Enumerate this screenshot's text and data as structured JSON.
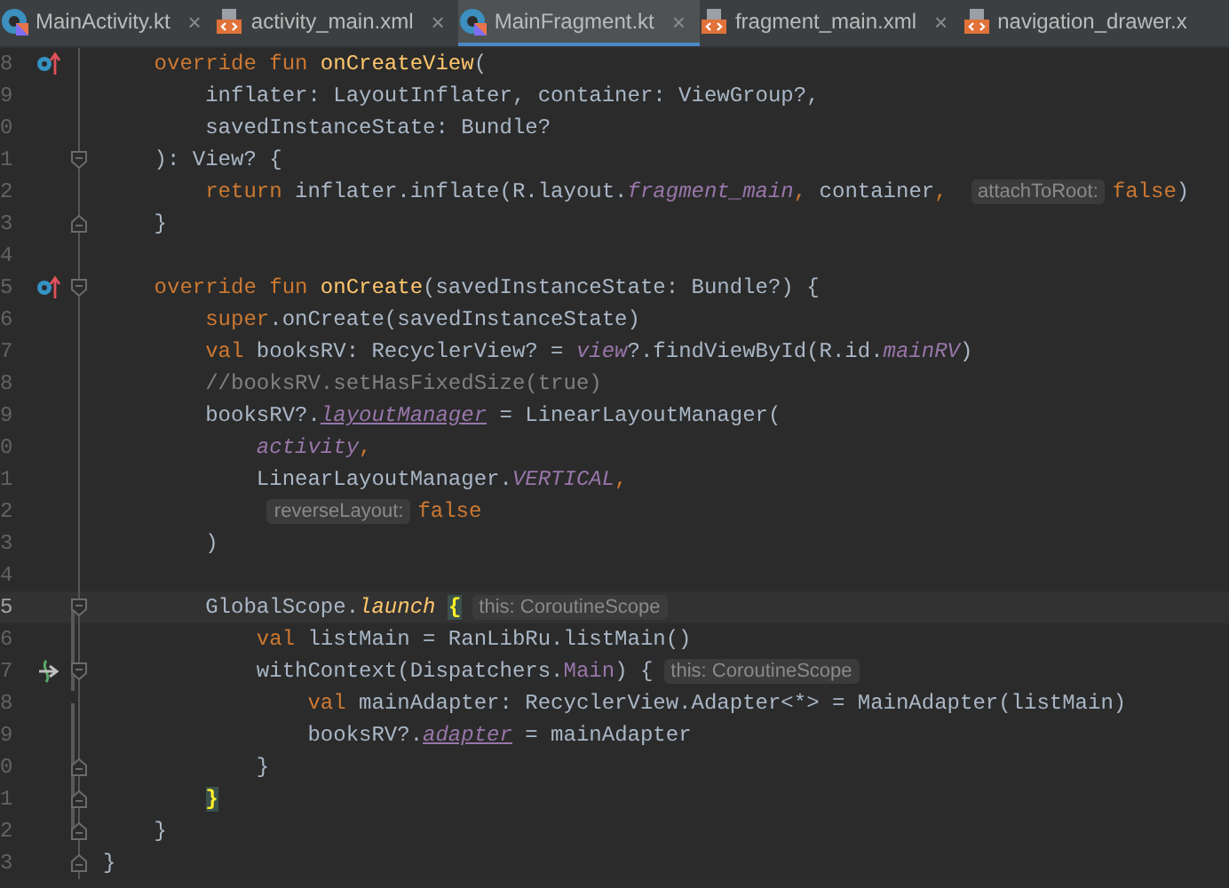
{
  "tabs": [
    {
      "label": "MainActivity.kt",
      "kind": "kotlin",
      "selected": false,
      "close": "×"
    },
    {
      "label": "activity_main.xml",
      "kind": "xml",
      "selected": false,
      "close": "×"
    },
    {
      "label": "MainFragment.kt",
      "kind": "kotlin",
      "selected": true,
      "close": "×"
    },
    {
      "label": "fragment_main.xml",
      "kind": "xml",
      "selected": false,
      "close": "×"
    },
    {
      "label": "navigation_drawer.x",
      "kind": "xml",
      "selected": false
    }
  ],
  "editor": {
    "lines": [
      {
        "number": "8",
        "gutter_icon": {
          "kind": "override"
        },
        "tokens": [
          {
            "kind": "keyword",
            "text": "    override fun "
          },
          {
            "kind": "function",
            "text": "onCreateView"
          },
          {
            "kind": "plain",
            "text": "("
          }
        ]
      },
      {
        "number": "9",
        "tokens": [
          {
            "kind": "plain",
            "text": "        inflater: LayoutInflater, container: ViewGroup?,"
          }
        ]
      },
      {
        "number": "0",
        "tokens": [
          {
            "kind": "plain",
            "text": "        savedInstanceState: Bundle?"
          }
        ]
      },
      {
        "number": "1",
        "fold_mark": {
          "kind": "start"
        },
        "tokens": [
          {
            "kind": "plain",
            "text": "    ): View? {"
          }
        ]
      },
      {
        "number": "2",
        "tokens": [
          {
            "kind": "keyword",
            "text": "        return "
          },
          {
            "kind": "plain",
            "text": "inflater.inflate(R.layout."
          },
          {
            "kind": "field",
            "text": "fragment_main"
          },
          {
            "kind": "keyword",
            "text": ", "
          },
          {
            "kind": "plain",
            "text": "container"
          },
          {
            "kind": "keyword",
            "text": ", "
          },
          {
            "kind": "hint",
            "text": "attachToRoot:"
          },
          {
            "kind": "keyword",
            "text": "false"
          },
          {
            "kind": "plain",
            "text": ")"
          }
        ]
      },
      {
        "number": "3",
        "fold_mark": {
          "kind": "end"
        },
        "tokens": [
          {
            "kind": "plain",
            "text": "    }"
          }
        ]
      },
      {
        "number": "4"
      },
      {
        "number": "5",
        "gutter_icon": {
          "kind": "override"
        },
        "fold_mark": {
          "kind": "start"
        },
        "tokens": [
          {
            "kind": "keyword",
            "text": "    override fun "
          },
          {
            "kind": "function",
            "text": "onCreate"
          },
          {
            "kind": "plain",
            "text": "(savedInstanceState: Bundle?) {"
          }
        ]
      },
      {
        "number": "6",
        "tokens": [
          {
            "kind": "keyword",
            "text": "        super"
          },
          {
            "kind": "plain",
            "text": ".onCreate(savedInstanceState)"
          }
        ]
      },
      {
        "number": "7",
        "tokens": [
          {
            "kind": "keyword",
            "text": "        val "
          },
          {
            "kind": "plain",
            "text": "booksRV: RecyclerView? = "
          },
          {
            "kind": "field",
            "text": "view"
          },
          {
            "kind": "plain",
            "text": "?.findViewById(R.id."
          },
          {
            "kind": "field",
            "text": "mainRV"
          },
          {
            "kind": "plain",
            "text": ")"
          }
        ]
      },
      {
        "number": "8",
        "tokens": [
          {
            "kind": "comment",
            "text": "        //booksRV.setHasFixedSize(true)"
          }
        ]
      },
      {
        "number": "9",
        "tokens": [
          {
            "kind": "plain",
            "text": "        booksRV?."
          },
          {
            "kind": "synthetic",
            "text": "layoutManager"
          },
          {
            "kind": "plain",
            "text": " = LinearLayoutManager("
          }
        ]
      },
      {
        "number": "0",
        "tokens": [
          {
            "kind": "field",
            "text": "            activity"
          },
          {
            "kind": "keyword",
            "text": ","
          }
        ]
      },
      {
        "number": "1",
        "tokens": [
          {
            "kind": "plain",
            "text": "            LinearLayoutManager."
          },
          {
            "kind": "field",
            "text": "VERTICAL"
          },
          {
            "kind": "keyword",
            "text": ","
          }
        ]
      },
      {
        "number": "2",
        "tokens": [
          {
            "kind": "hint",
            "text": "            reverseLayout:"
          },
          {
            "kind": "keyword",
            "text": "false"
          }
        ]
      },
      {
        "number": "3",
        "tokens": [
          {
            "kind": "plain",
            "text": "        )"
          }
        ]
      },
      {
        "number": "4"
      },
      {
        "number": "5",
        "current": true,
        "changed": true,
        "fold_mark": {
          "kind": "start"
        },
        "tokens": [
          {
            "kind": "plain",
            "text": "        GlobalScope."
          },
          {
            "kind": "call",
            "text": "launch"
          },
          {
            "kind": "brace",
            "text": " {"
          },
          {
            "kind": "hint",
            "text": "this: CoroutineScope"
          }
        ]
      },
      {
        "number": "6",
        "changed": true,
        "tokens": [
          {
            "kind": "keyword",
            "text": "            val "
          },
          {
            "kind": "plain",
            "text": "listMain = RanLibRu.listMain()"
          }
        ]
      },
      {
        "number": "7",
        "changed": true,
        "gutter_icon": {
          "kind": "suspend"
        },
        "fold_mark": {
          "kind": "start"
        },
        "tokens": [
          {
            "kind": "plain",
            "text": "            withContext(Dispatchers."
          },
          {
            "kind": "member",
            "text": "Main"
          },
          {
            "kind": "plain",
            "text": ") {"
          },
          {
            "kind": "hint",
            "text": "this: CoroutineScope"
          }
        ]
      },
      {
        "number": "8",
        "changed": true,
        "tokens": [
          {
            "kind": "keyword",
            "text": "                val "
          },
          {
            "kind": "plain",
            "text": "mainAdapter: RecyclerView.Adapter<*> = MainAdapter(listMain)"
          }
        ]
      },
      {
        "number": "9",
        "changed": true,
        "tokens": [
          {
            "kind": "plain",
            "text": "                booksRV?."
          },
          {
            "kind": "synthetic",
            "text": "adapter"
          },
          {
            "kind": "plain",
            "text": " = mainAdapter"
          }
        ]
      },
      {
        "number": "0",
        "changed": true,
        "fold_mark": {
          "kind": "end"
        },
        "tokens": [
          {
            "kind": "plain",
            "text": "            }"
          }
        ]
      },
      {
        "number": "1",
        "changed": true,
        "fold_mark": {
          "kind": "end"
        },
        "tokens": [
          {
            "kind": "brace",
            "text": "        }"
          }
        ]
      },
      {
        "number": "2",
        "fold_mark": {
          "kind": "end"
        },
        "tokens": [
          {
            "kind": "plain",
            "text": "    }"
          }
        ]
      },
      {
        "number": "3",
        "fold_mark": {
          "kind": "end"
        },
        "tokens": [
          {
            "kind": "plain",
            "text": "}"
          }
        ]
      }
    ]
  }
}
